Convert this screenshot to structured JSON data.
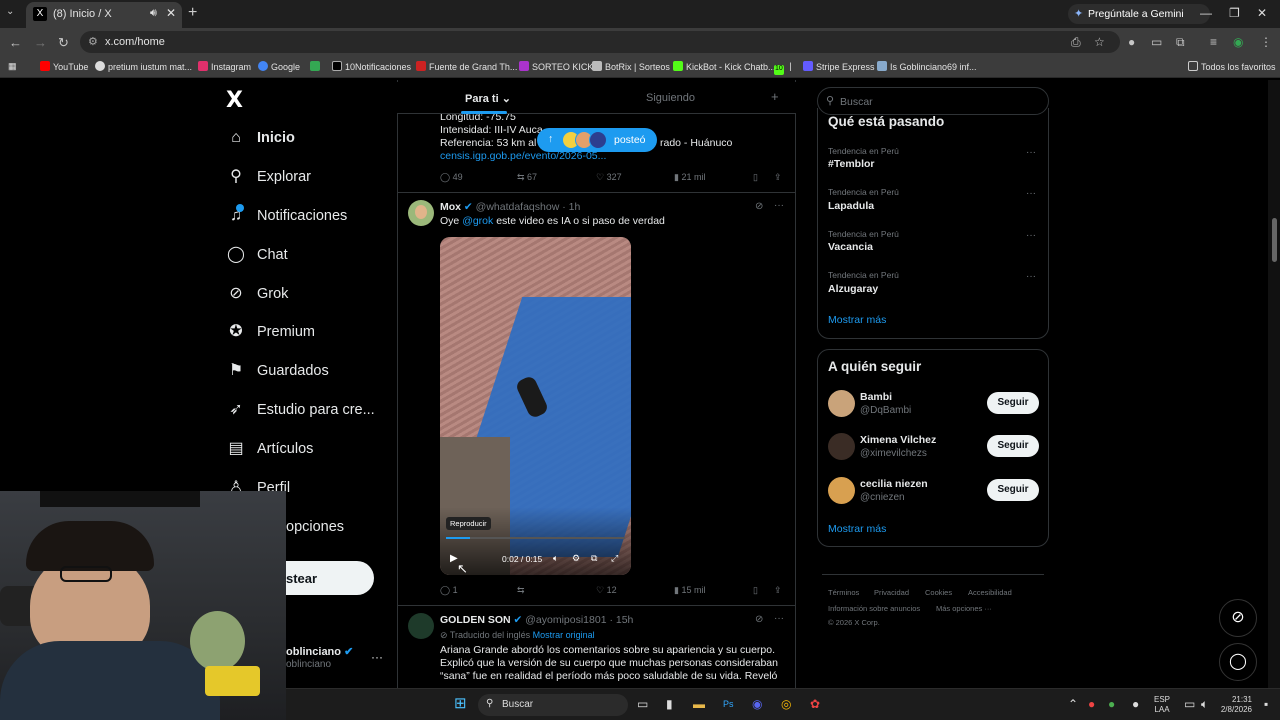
{
  "browser": {
    "tab_title": "(8) Inicio / X",
    "tab_favicon": "X",
    "gemini_label": "Pregúntale a Gemini",
    "url": "x.com/home",
    "bookmarks": [
      {
        "label": "YouTube",
        "color": "#ff0000"
      },
      {
        "label": "pretium iustum mat...",
        "color": "#dddddd"
      },
      {
        "label": "Instagram",
        "color": "#e1306c"
      },
      {
        "label": "Google",
        "color": "#4285f4"
      },
      {
        "label": "",
        "color": "#34a853"
      },
      {
        "label": "10Notificaciones",
        "color": "#000000"
      },
      {
        "label": "Fuente de Grand Th...",
        "color": "#cc2222"
      },
      {
        "label": "SORTEO KICK",
        "color": "#aa33cc"
      },
      {
        "label": "BotRix | Sorteos",
        "color": "#bbbbbb"
      },
      {
        "label": "KickBot - Kick Chatb...",
        "color": "#53fc18"
      },
      {
        "label": "10",
        "color": "#53fc18"
      },
      {
        "label": "Stripe Express",
        "color": "#635bff"
      },
      {
        "label": "Is Goblinciano69 inf...",
        "color": "#88aacc"
      }
    ],
    "all_bookmarks": "Todos los favoritos"
  },
  "sidebar": {
    "logo": "X",
    "items": [
      {
        "label": "Inicio",
        "icon": "home-icon",
        "glyph": "⌂"
      },
      {
        "label": "Explorar",
        "icon": "search-icon",
        "glyph": "⚲"
      },
      {
        "label": "Notificaciones",
        "icon": "bell-icon",
        "glyph": "🔔"
      },
      {
        "label": "Chat",
        "icon": "chat-icon",
        "glyph": "◯"
      },
      {
        "label": "Grok",
        "icon": "grok-icon",
        "glyph": "⊘"
      },
      {
        "label": "Premium",
        "icon": "premium-icon",
        "glyph": "✪"
      },
      {
        "label": "Guardados",
        "icon": "bookmark-icon",
        "glyph": "▯"
      },
      {
        "label": "Estudio para cre...",
        "icon": "rocket-icon",
        "glyph": "➶"
      },
      {
        "label": "Artículos",
        "icon": "articles-icon",
        "glyph": "▤"
      },
      {
        "label": "Perfil",
        "icon": "profile-icon",
        "glyph": "♙"
      }
    ],
    "more_label": "opciones",
    "post_label": "stear",
    "account_name": "oblinciano",
    "account_handle": "oblinciano"
  },
  "feed": {
    "tabs": [
      "Para ti",
      "Siguiendo"
    ],
    "new_posts_label": "posteó",
    "partial_tweet": {
      "line1": "Longitud: -75.75",
      "line2": "Intensidad: III-IV Auca",
      "line3_left": "Referencia: 53 km al",
      "line3_right": "rado - Huánuco",
      "link": "censis.igp.gob.pe/evento/2026-05...",
      "replies": "49",
      "reposts": "67",
      "likes": "327",
      "views": "21 mil"
    },
    "tweet": {
      "author": "Mox",
      "handle": "@whatdafaqshow · 1h",
      "text_pre": "Oye ",
      "mention": "@grok",
      "text_post": " este video es IA o si paso de verdad",
      "video_time": "0:02 / 0:15",
      "tooltip": "Reproducir",
      "replies": "1",
      "reposts": "",
      "likes": "12",
      "views": "15 mil"
    },
    "tweet2": {
      "author": "GOLDEN SON",
      "handle": "@ayomiposi1801 · 15h",
      "translated": "Traducido del inglés",
      "show_original": "Mostrar original",
      "lines": [
        "Ariana Grande abordó los comentarios sobre su apariencia y su cuerpo.",
        "Explicó que la versión de su cuerpo que muchas personas consideraban",
        "“sana” fue en realidad el período más poco saludable de su vida. Reveló"
      ]
    }
  },
  "right": {
    "search_placeholder": "Buscar",
    "trends_title": "Qué está pasando",
    "trends": [
      {
        "context": "Tendencia en Perú",
        "name": "#Temblor"
      },
      {
        "context": "Tendencia en Perú",
        "name": "Lapadula"
      },
      {
        "context": "Tendencia en Perú",
        "name": "Vacancia"
      },
      {
        "context": "Tendencia en Perú",
        "name": "Alzugaray"
      }
    ],
    "show_more": "Mostrar más",
    "follow_title": "A quién seguir",
    "follow": [
      {
        "name": "Bambi",
        "handle": "@DqBambi",
        "color": "#c9a37a"
      },
      {
        "name": "Ximena Vilchez",
        "handle": "@ximevilchezs",
        "color": "#3a2c25"
      },
      {
        "name": "cecilia niezen",
        "handle": "@cniezen",
        "color": "#d8a050"
      }
    ],
    "follow_btn": "Seguir",
    "footer": [
      "Términos",
      "Privacidad",
      "Cookies",
      "Accesibilidad",
      "Información sobre anuncios",
      "Más opciones ···",
      "© 2026 X Corp."
    ]
  },
  "taskbar": {
    "search": "Buscar",
    "lang": "ESP",
    "lang2": "LAA",
    "time": "21:31",
    "date": "2/8/2026"
  }
}
